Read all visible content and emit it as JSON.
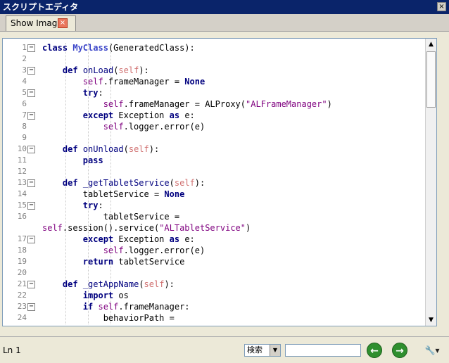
{
  "window": {
    "title": "スクリプトエディタ",
    "close_glyph": "×"
  },
  "tab": {
    "label": "Show Image",
    "close_glyph": "×"
  },
  "scrollbar": {
    "up_glyph": "▲",
    "down_glyph": "▼"
  },
  "status": {
    "line_indicator": "Ln 1",
    "search_mode": "検索",
    "search_value": "",
    "prev_glyph": "←",
    "next_glyph": "→",
    "tools_glyph": "🔧▾"
  },
  "code": {
    "line_numbers": [
      "1",
      "2",
      "3",
      "4",
      "5",
      "6",
      "7",
      "8",
      "9",
      "10",
      "11",
      "12",
      "13",
      "14",
      "15",
      "16",
      "",
      "17",
      "18",
      "19",
      "20",
      "21",
      "22",
      "23",
      "24"
    ],
    "folds": [
      "1",
      "3",
      "5",
      "7",
      "10",
      "13",
      "15",
      "17",
      "21",
      "23"
    ]
  }
}
